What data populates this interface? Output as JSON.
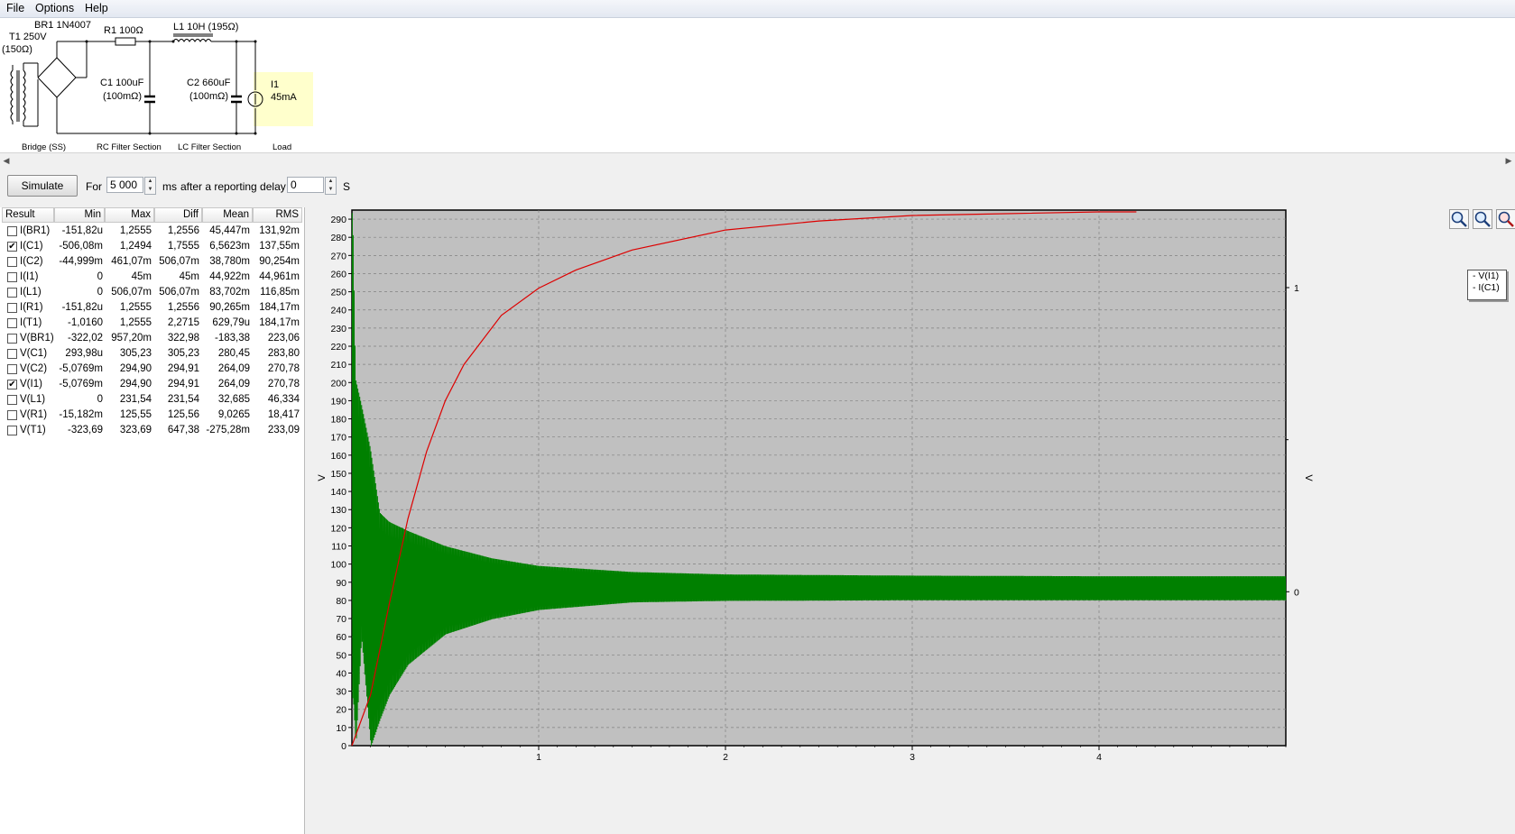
{
  "menu": [
    "File",
    "Options",
    "Help"
  ],
  "schematic": {
    "transformer": [
      "T1 250V",
      "(150Ω)"
    ],
    "bridge": "BR1 1N4007",
    "r1": "R1 100Ω",
    "l1": "L1 10H (195Ω)",
    "c1": [
      "C1 100uF",
      "(100mΩ)"
    ],
    "c2": [
      "C2 660uF",
      "(100mΩ)"
    ],
    "load": [
      "I1",
      "45mA"
    ],
    "sections": [
      "Bridge (SS)",
      "RC Filter Section",
      "LC Filter Section",
      "Load"
    ]
  },
  "toolbar": {
    "simulate": "Simulate",
    "for_label": "For",
    "duration": "5 000",
    "ms_label": "ms",
    "delay_label": "after a reporting delay of",
    "delay": "0",
    "s_label": "S"
  },
  "results": {
    "headers": [
      "Result",
      "Min",
      "Max",
      "Diff",
      "Mean",
      "RMS"
    ],
    "rows": [
      {
        "checked": false,
        "name": "I(BR1)",
        "min": "-151,82u",
        "max": "1,2555",
        "diff": "1,2556",
        "mean": "45,447m",
        "rms": "131,92m"
      },
      {
        "checked": true,
        "name": "I(C1)",
        "min": "-506,08m",
        "max": "1,2494",
        "diff": "1,7555",
        "mean": "6,5623m",
        "rms": "137,55m"
      },
      {
        "checked": false,
        "name": "I(C2)",
        "min": "-44,999m",
        "max": "461,07m",
        "diff": "506,07m",
        "mean": "38,780m",
        "rms": "90,254m"
      },
      {
        "checked": false,
        "name": "I(I1)",
        "min": "0",
        "max": "45m",
        "diff": "45m",
        "mean": "44,922m",
        "rms": "44,961m"
      },
      {
        "checked": false,
        "name": "I(L1)",
        "min": "0",
        "max": "506,07m",
        "diff": "506,07m",
        "mean": "83,702m",
        "rms": "116,85m"
      },
      {
        "checked": false,
        "name": "I(R1)",
        "min": "-151,82u",
        "max": "1,2555",
        "diff": "1,2556",
        "mean": "90,265m",
        "rms": "184,17m"
      },
      {
        "checked": false,
        "name": "I(T1)",
        "min": "-1,0160",
        "max": "1,2555",
        "diff": "2,2715",
        "mean": "629,79u",
        "rms": "184,17m"
      },
      {
        "checked": false,
        "name": "V(BR1)",
        "min": "-322,02",
        "max": "957,20m",
        "diff": "322,98",
        "mean": "-183,38",
        "rms": "223,06"
      },
      {
        "checked": false,
        "name": "V(C1)",
        "min": "293,98u",
        "max": "305,23",
        "diff": "305,23",
        "mean": "280,45",
        "rms": "283,80"
      },
      {
        "checked": false,
        "name": "V(C2)",
        "min": "-5,0769m",
        "max": "294,90",
        "diff": "294,91",
        "mean": "264,09",
        "rms": "270,78"
      },
      {
        "checked": true,
        "name": "V(I1)",
        "min": "-5,0769m",
        "max": "294,90",
        "diff": "294,91",
        "mean": "264,09",
        "rms": "270,78"
      },
      {
        "checked": false,
        "name": "V(L1)",
        "min": "0",
        "max": "231,54",
        "diff": "231,54",
        "mean": "32,685",
        "rms": "46,334"
      },
      {
        "checked": false,
        "name": "V(R1)",
        "min": "-15,182m",
        "max": "125,55",
        "diff": "125,56",
        "mean": "9,0265",
        "rms": "18,417"
      },
      {
        "checked": false,
        "name": "V(T1)",
        "min": "-323,69",
        "max": "323,69",
        "diff": "647,38",
        "mean": "-275,28m",
        "rms": "233,09"
      }
    ]
  },
  "zoom_icons": [
    "zoom-in-icon",
    "zoom-out-icon",
    "zoom-reset-icon"
  ],
  "colors": {
    "plot_bg": "#c0c0c0",
    "vi1": "#dd0000",
    "ic1": "#008000",
    "grid": "#808080"
  },
  "chart_data": {
    "type": "line",
    "xlim": [
      0,
      5
    ],
    "x_ticks": [
      1,
      2,
      3,
      4
    ],
    "y_left": {
      "label": "V",
      "lim": [
        0,
        295
      ],
      "ticks": [
        0,
        10,
        20,
        30,
        40,
        50,
        60,
        70,
        80,
        90,
        100,
        110,
        120,
        130,
        140,
        150,
        160,
        170,
        180,
        190,
        200,
        210,
        220,
        230,
        240,
        250,
        260,
        270,
        280,
        290
      ]
    },
    "y_right": {
      "label": "V",
      "ticks": [
        0,
        1
      ],
      "lim": [
        -0.506,
        1.255
      ]
    },
    "legend": {
      "placement": "top-right outside",
      "entries": [
        "V(I1)",
        "I(C1)"
      ]
    },
    "grid": true,
    "series": [
      {
        "name": "V(I1)",
        "axis": "left",
        "x": [
          0,
          0.1,
          0.2,
          0.3,
          0.4,
          0.5,
          0.6,
          0.8,
          1.0,
          1.2,
          1.5,
          2.0,
          2.5,
          3.0,
          3.5,
          4.0,
          4.2
        ],
        "values": [
          0,
          28,
          78,
          125,
          162,
          190,
          210,
          237,
          252,
          262,
          273,
          284,
          289,
          292,
          293,
          294,
          294
        ]
      },
      {
        "name": "I(C1)",
        "axis": "right",
        "kind": "ripple-envelope",
        "x": [
          0.005,
          0.02,
          0.05,
          0.1,
          0.15,
          0.2,
          0.3,
          0.5,
          0.75,
          1.0,
          1.5,
          2.0,
          3.0,
          4.0,
          5.0
        ],
        "upper": [
          1.245,
          0.7,
          0.62,
          0.47,
          0.26,
          0.23,
          0.2,
          0.15,
          0.11,
          0.085,
          0.065,
          0.057,
          0.053,
          0.051,
          0.051
        ],
        "lower": [
          -0.35,
          -0.506,
          -0.15,
          -0.51,
          -0.42,
          -0.34,
          -0.24,
          -0.14,
          -0.09,
          -0.06,
          -0.035,
          -0.03,
          -0.028,
          -0.028,
          -0.028
        ]
      }
    ]
  }
}
